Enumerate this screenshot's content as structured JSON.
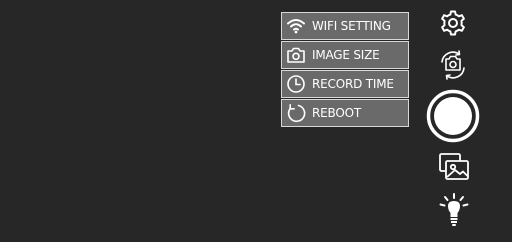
{
  "menu": {
    "items": [
      {
        "label": "WIFI SETTING",
        "icon": "wifi-icon"
      },
      {
        "label": "IMAGE SIZE",
        "icon": "camera-icon"
      },
      {
        "label": "RECORD TIME",
        "icon": "clock-icon"
      },
      {
        "label": "REBOOT",
        "icon": "reboot-icon"
      }
    ]
  },
  "toolbar": {
    "settings_icon": "gear-icon",
    "switch_camera_icon": "switch-camera-icon",
    "shutter_icon": "shutter-icon",
    "gallery_icon": "gallery-icon",
    "light_icon": "lightbulb-icon"
  },
  "colors": {
    "background": "#272727",
    "menu_item": "#6a6a6a",
    "menu_border": "#d8d8d8",
    "foreground": "#ffffff"
  }
}
